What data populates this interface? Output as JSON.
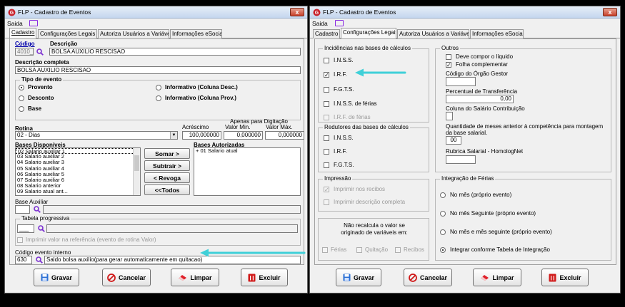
{
  "left": {
    "title": "FLP - Cadastro de Eventos",
    "close": "x",
    "menu": {
      "saida": "Saida"
    },
    "tabs": [
      "Cadastro",
      "Configurações Legais",
      "Autoriza Usuários a Variáveis",
      "Informações eSocial"
    ],
    "codigo_label": "Código",
    "descricao_label": "Descrição",
    "codigo_value": "4010_",
    "descricao_value": "BOLSA AUXILIO RESCISAO",
    "desc_completa_label": "Descrição completa",
    "desc_completa_value": "BOLSA AUXILIO RESCISAO",
    "tipo_evento": {
      "title": "Tipo de evento",
      "options": [
        "Provento",
        "Desconto",
        "Base",
        "Informativo (Coluna Desc.)",
        "Informativo (Coluna Prov.)"
      ],
      "selected": "Provento"
    },
    "rotina_label": "Rotina",
    "rotina_value": "02 - Dias",
    "acrescimo_label": "Acréscimo",
    "acrescimo_value": "100,000000",
    "apenas_label": "Apenas para Digitação",
    "valor_min_label": "Valor Min.",
    "valor_min_value": "0,000000",
    "valor_max_label": "Valor Máx.",
    "valor_max_value": "0,000000",
    "bases_disp_label": "Bases Disponíveis",
    "bases_disp": [
      "02 Salario auxiliar 1",
      "03 Salario auxiliar 2",
      "04 Salario auxiliar 3",
      "05 Salario auxiliar 4",
      "06 Salario auxiliar 5",
      "07 Salario auxiliar 6",
      "08 Salario anterior",
      "09 Salario atual ant..."
    ],
    "buttons_mid": [
      "Somar >",
      "Subtrair >",
      "< Revoga",
      "<<Todos"
    ],
    "bases_aut_label": "Bases Autorizadas",
    "bases_aut": [
      "+ 01 Salario atual"
    ],
    "base_auxiliar_label": "Base Auxiliar",
    "tabela_label": "Tabela progressiva",
    "tabela_value": "___",
    "imprimir_label": "Imprimir valor na referência (evento de rotina Valor)",
    "codigo_interno_label": "Código evento interno",
    "codigo_interno_value": "630",
    "codigo_interno_desc": "Saldo bolsa auxilio(para gerar automaticamente em quitacao)",
    "footer": [
      "Gravar",
      "Cancelar",
      "Limpar",
      "Excluir"
    ]
  },
  "right": {
    "title": "FLP - Cadastro de Eventos",
    "close": "x",
    "menu": {
      "saida": "Saida"
    },
    "tabs": [
      "Cadastro",
      "Configurações Legais",
      "Autoriza Usuários a Variáveis",
      "Informações eSocial"
    ],
    "incidencias": {
      "title": "Incidências nas bases de cálculos",
      "items": [
        {
          "label": "I.N.S.S.",
          "checked": false,
          "disabled": false
        },
        {
          "label": "I.R.F.",
          "checked": true,
          "disabled": false
        },
        {
          "label": "F.G.T.S.",
          "checked": false,
          "disabled": false
        },
        {
          "label": "I.N.S.S. de férias",
          "checked": false,
          "disabled": false
        },
        {
          "label": "I.R.F. de férias",
          "checked": false,
          "disabled": true
        }
      ]
    },
    "redutores": {
      "title": "Redutores das bases de cálculos",
      "items": [
        "I.N.S.S.",
        "I.R.F.",
        "F.G.T.S."
      ]
    },
    "impressao": {
      "title": "Impressão",
      "items": [
        {
          "label": "Imprimir nos recibos",
          "checked": true
        },
        {
          "label": "Imprimir descrição completa",
          "checked": false
        }
      ]
    },
    "recalcula": {
      "text": "Não recalcula o valor se originado de variáveis em:",
      "items": [
        "Férias",
        "Quitação",
        "Recibos"
      ]
    },
    "outros": {
      "title": "Outros",
      "deve_compor": "Deve compor o líquido",
      "folha_compl": "Folha complementar",
      "folha_compl_checked": true,
      "orgao_gestor": "Código do Órgão Gestor",
      "perc_transf": "Percentual de Transferência",
      "perc_transf_value": "0,00",
      "coluna_salario": "Coluna do Salário Contribuição",
      "qtd_meses": "Quantidade de meses anterior à competência para montagem da base salarial.",
      "qtd_meses_value": "00",
      "rubrica": "Rubrica Salarial - HomologNet"
    },
    "integracao": {
      "title": "Integração de Férias",
      "options": [
        "No mês (próprio evento)",
        "No mês Seguinte (próprio evento)",
        "No mês e mês seguinte (próprio evento)",
        "Integrar conforme Tabela de Integração"
      ],
      "selected": "Integrar conforme Tabela de Integração"
    },
    "footer": [
      "Gravar",
      "Cancelar",
      "Limpar",
      "Excluir"
    ]
  },
  "colors": {
    "annotation_arrow": "#3fd0d8",
    "title_gradient_top": "#e6eef8",
    "close_red": "#c8402a"
  }
}
